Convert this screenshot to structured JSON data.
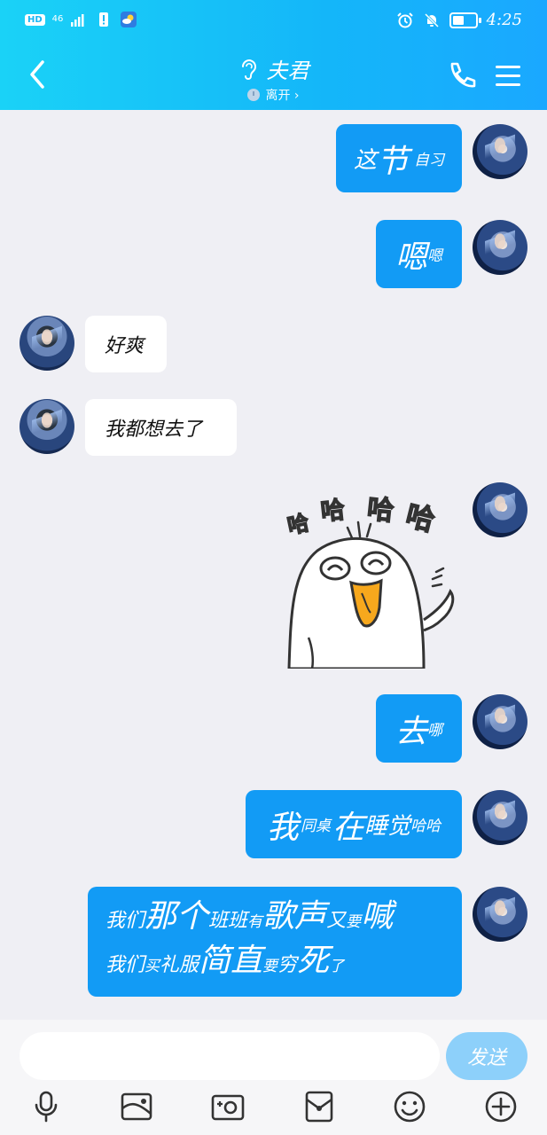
{
  "status_bar": {
    "hd": "HD",
    "network": "46",
    "time": "4:25"
  },
  "header": {
    "title": "夫君",
    "subtitle": "离开 ›"
  },
  "messages": [
    {
      "side": "me",
      "parts": [
        "这",
        "节",
        "自习"
      ]
    },
    {
      "side": "me",
      "parts": [
        "嗯",
        "嗯"
      ]
    },
    {
      "side": "them",
      "text": "好爽"
    },
    {
      "side": "them",
      "text": "我都想去了"
    },
    {
      "side": "me",
      "sticker": "哈哈哈哈"
    },
    {
      "side": "me",
      "parts": [
        "去",
        "哪"
      ]
    },
    {
      "side": "me",
      "parts": [
        "我",
        "同桌",
        "在",
        "睡觉",
        "哈哈"
      ]
    },
    {
      "side": "me",
      "line1": [
        "我们",
        "那个",
        "班班",
        "有",
        "歌声",
        "又",
        "要",
        "喊"
      ],
      "line2": [
        "我们",
        "买",
        "礼服",
        "简直",
        "要",
        "穷",
        "死",
        "了"
      ]
    }
  ],
  "input": {
    "placeholder": "",
    "send_label": "发送"
  },
  "colors": {
    "header_start": "#1ad2f7",
    "header_end": "#1aa8ff",
    "bubble_me": "#129bf5",
    "bubble_them": "#ffffff",
    "send_button": "#8dd0fa",
    "background": "#efeff4"
  },
  "toolbar_icons": [
    "microphone-icon",
    "image-icon",
    "camera-icon",
    "red-packet-icon",
    "emoji-icon",
    "plus-icon"
  ]
}
